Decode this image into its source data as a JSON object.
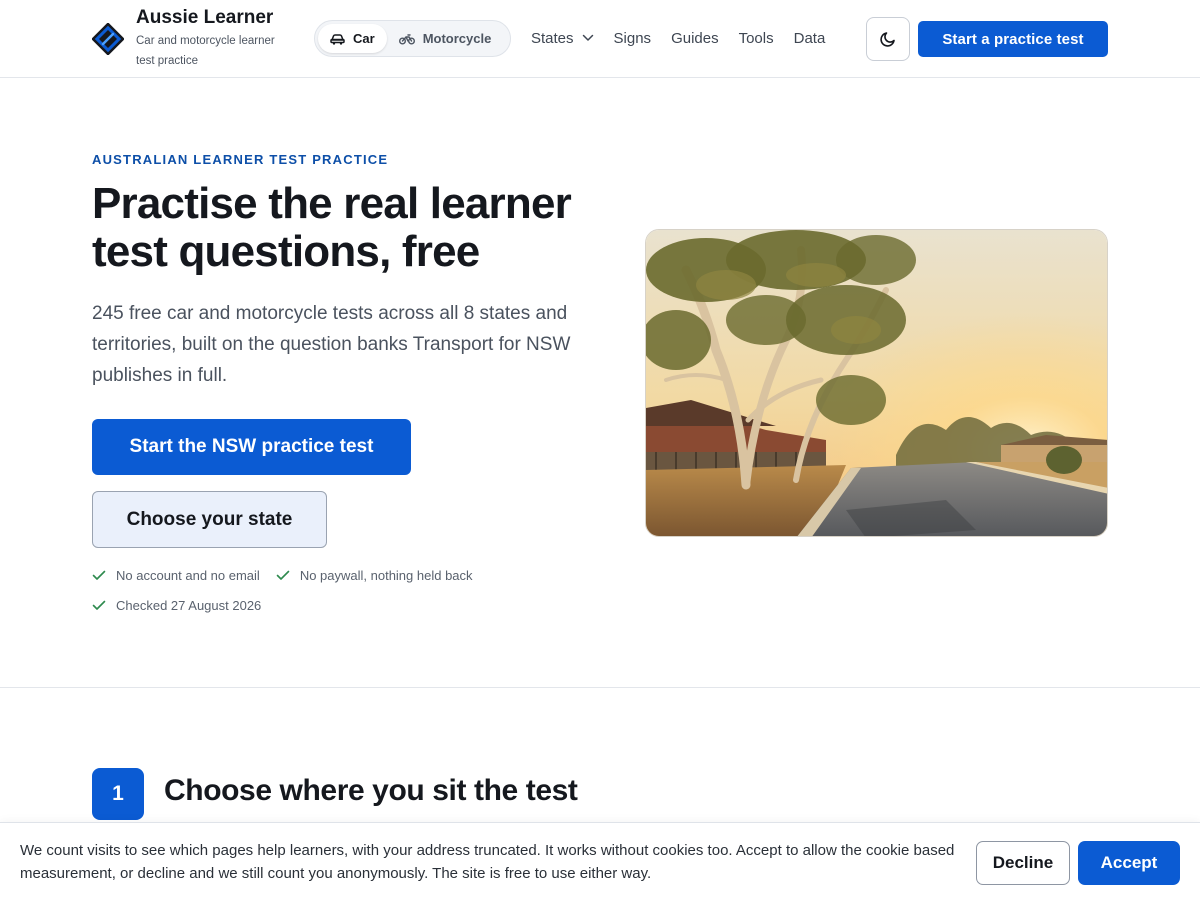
{
  "brand": {
    "name": "Aussie Learner",
    "tagline": "Car and motorcycle learner test practice"
  },
  "mode_toggle": {
    "car_label": "Car",
    "motorcycle_label": "Motorcycle",
    "active": "Car"
  },
  "nav": {
    "states_label": "States",
    "signs_label": "Signs",
    "guides_label": "Guides",
    "tools_label": "Tools",
    "data_label": "Data"
  },
  "header_cta": "Start a practice test",
  "hero": {
    "eyebrow": "AUSTRALIAN LEARNER TEST PRACTICE",
    "title": "Practise the real learner test questions, free",
    "lead": "245 free car and motorcycle tests across all 8 states and territories, built on the question banks Transport for NSW publishes in full.",
    "primary_button": "Start the NSW practice test",
    "secondary_button": "Choose your state",
    "checks": [
      "No account and no email",
      "No paywall, nothing held back",
      "Checked 27 August 2026"
    ]
  },
  "step": {
    "number": "1",
    "title": "Choose where you sit the test"
  },
  "cookie": {
    "text": "We count visits to see which pages help learners, with your address truncated. It works without cookies too. Accept to allow the cookie based measurement, or decline and we still count you anonymously. The site is free to use either way.",
    "decline": "Decline",
    "accept": "Accept"
  },
  "colors": {
    "accent": "#0b5bd3",
    "eyebrow": "#0d4fa8",
    "check": "#2e8a4e"
  },
  "icons": {
    "logo": "diamond-logo-icon",
    "car": "car-icon",
    "motorcycle": "motorcycle-icon",
    "states_dropdown": "chevron-down-icon",
    "theme": "moon-icon",
    "check": "check-icon"
  }
}
